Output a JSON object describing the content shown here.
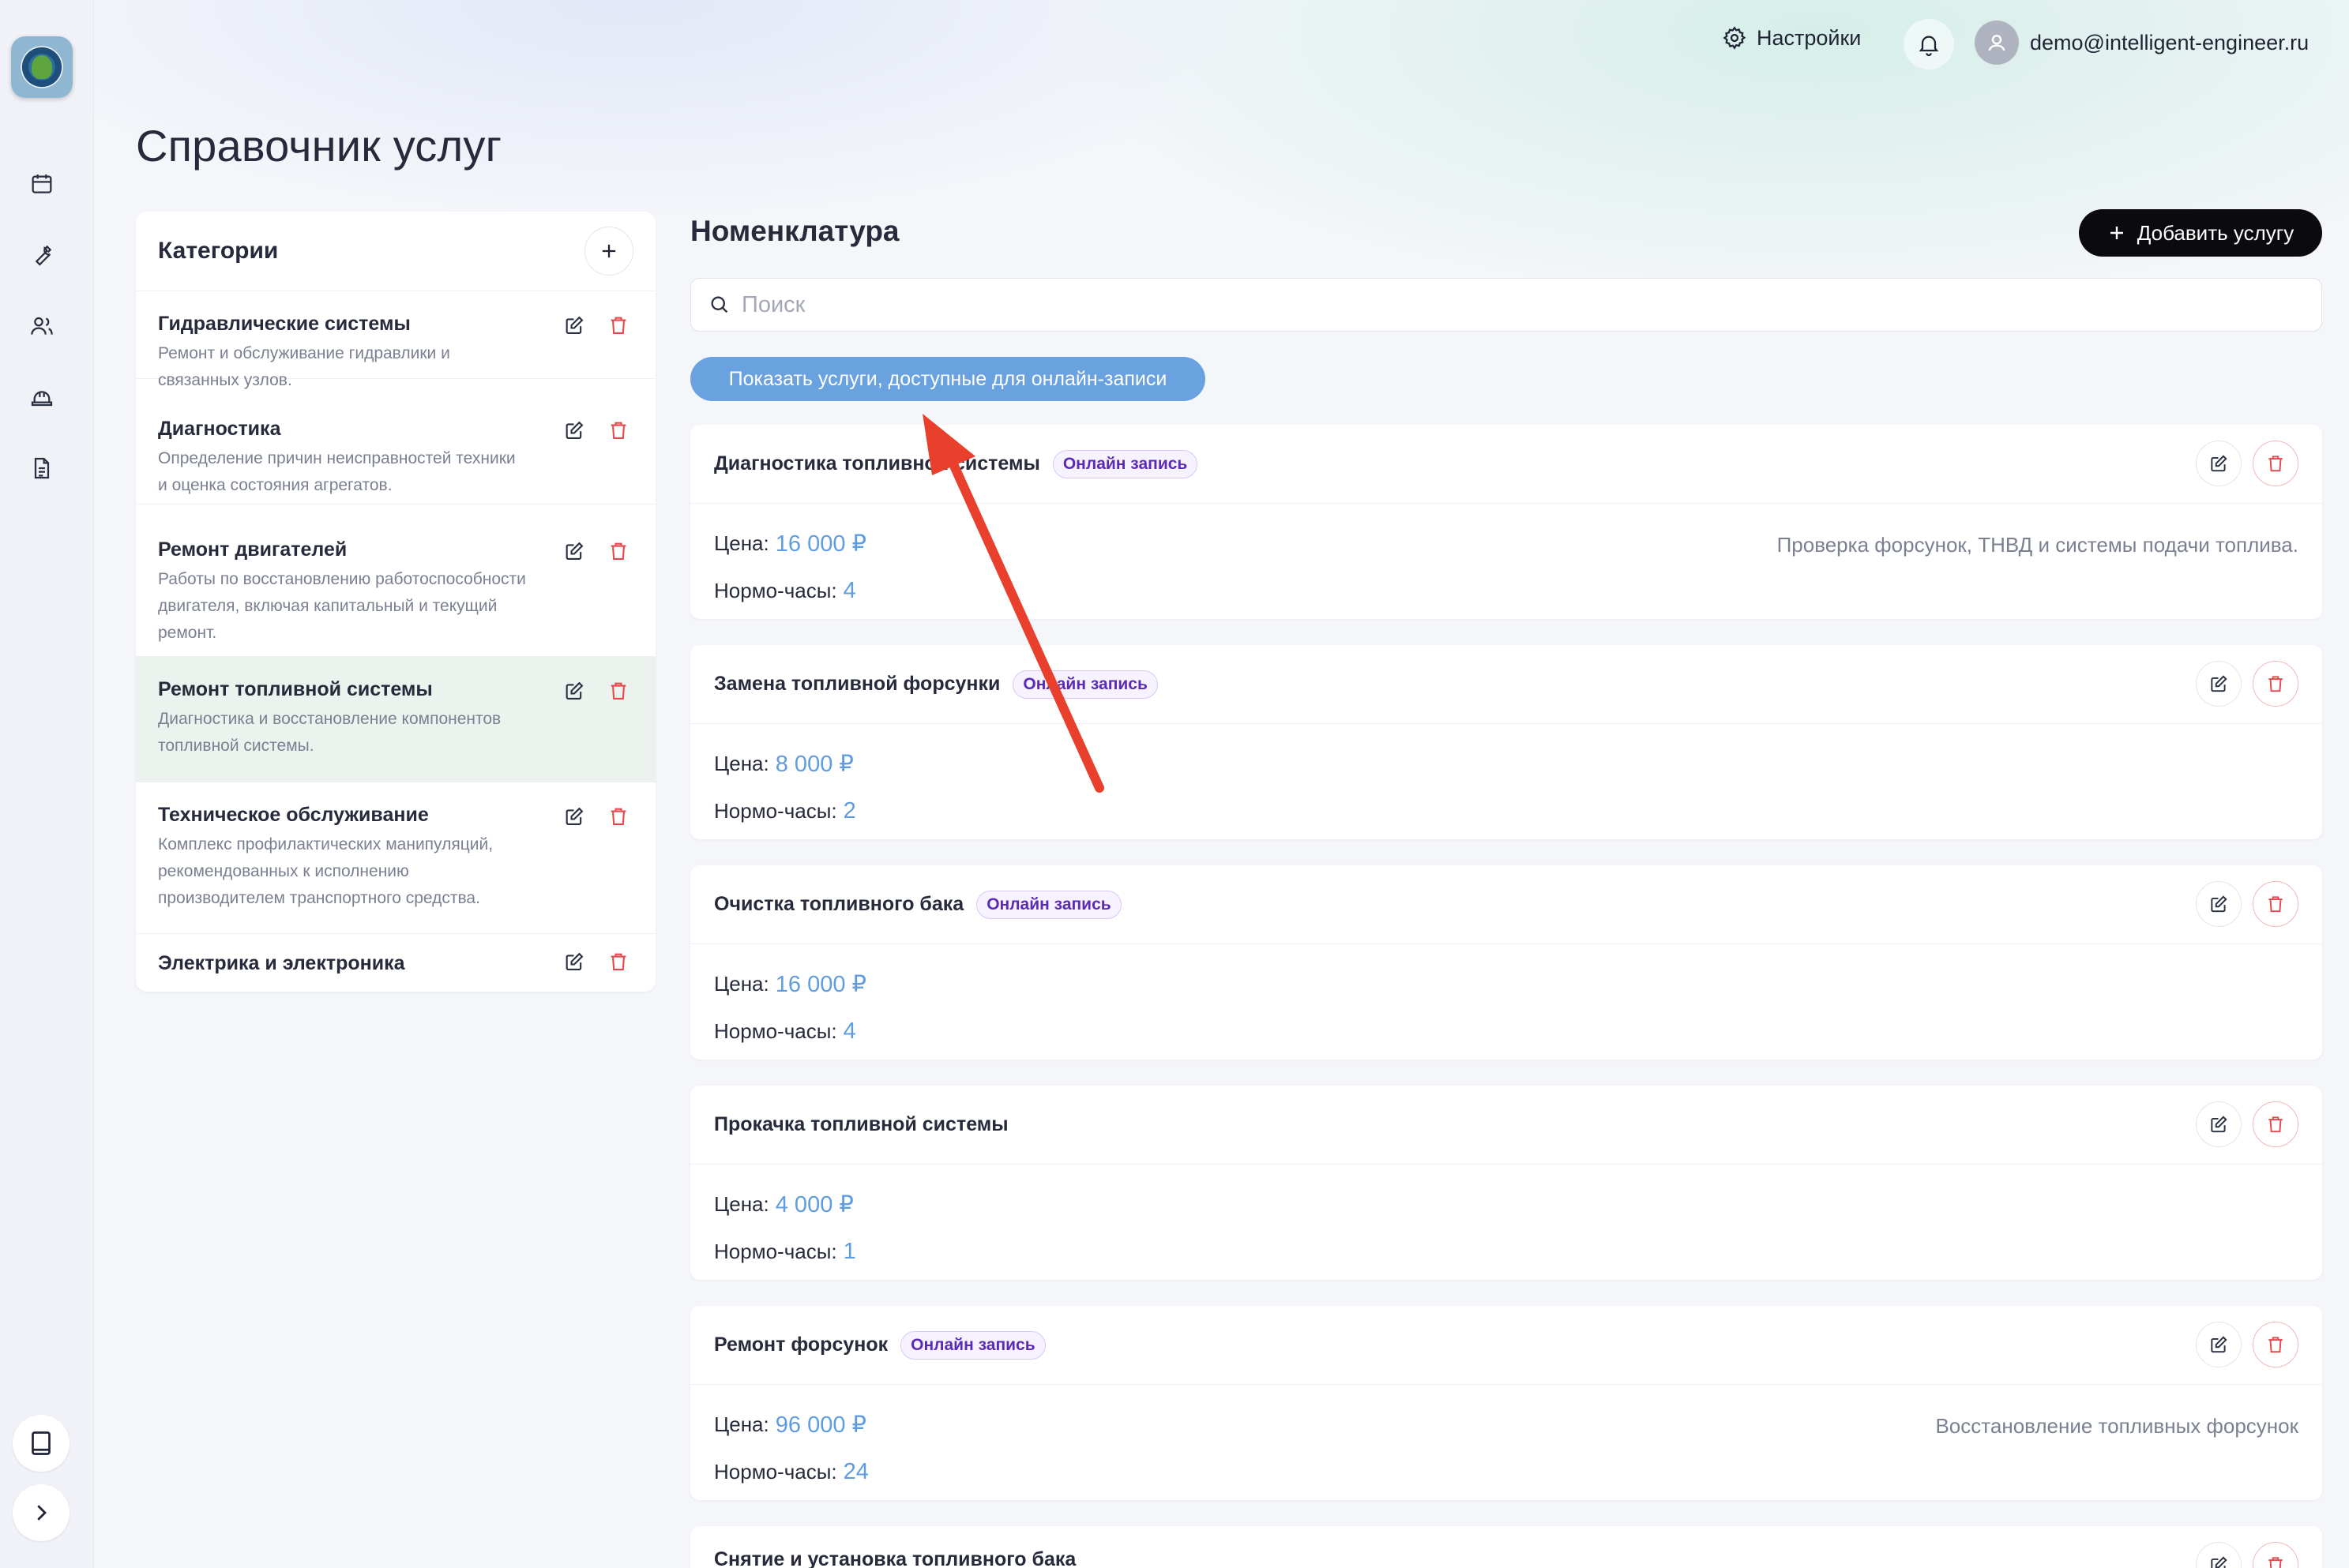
{
  "header": {
    "settings_label": "Настройки",
    "user_email": "demo@intelligent-engineer.ru"
  },
  "page": {
    "title": "Справочник услуг"
  },
  "categories": {
    "title": "Категории",
    "items": [
      {
        "name": "Гидравлические системы",
        "desc": "Ремонт и обслуживание гидравлики и связанных узлов."
      },
      {
        "name": "Диагностика",
        "desc": "Определение причин неисправностей техники и оценка состояния агрегатов."
      },
      {
        "name": "Ремонт двигателей",
        "desc": "Работы по восстановлению работоспособности двигателя, включая капитальный и текущий ремонт."
      },
      {
        "name": "Ремонт топливной системы",
        "desc": "Диагностика и восстановление компонентов топливной системы."
      },
      {
        "name": "Техническое обслуживание",
        "desc": "Комплекс профилактических манипуляций, рекомендованных к исполнению производителем транспортного средства."
      },
      {
        "name": "Электрика и электроника",
        "desc": ""
      }
    ]
  },
  "nomenclature": {
    "title": "Номенклатура",
    "add_label": "Добавить услугу",
    "search_placeholder": "Поиск",
    "filter_label": "Показать услуги, доступные для онлайн-записи",
    "price_label": "Цена:",
    "hours_label": "Нормо-часы:",
    "badge_label": "Онлайн запись",
    "services": [
      {
        "name": "Диагностика топливной системы",
        "badge": "Онлайн запись",
        "price": "16 000 ₽",
        "hours": "4",
        "desc": "Проверка форсунок, ТНВД и системы подачи топлива."
      },
      {
        "name": "Замена топливной форсунки",
        "badge": "Онлайн запись",
        "price": "8 000 ₽",
        "hours": "2",
        "desc": ""
      },
      {
        "name": "Очистка топливного бака",
        "badge": "Онлайн запись",
        "price": "16 000 ₽",
        "hours": "4",
        "desc": ""
      },
      {
        "name": "Прокачка топливной системы",
        "badge": "",
        "price": "4 000 ₽",
        "hours": "1",
        "desc": ""
      },
      {
        "name": "Ремонт форсунок",
        "badge": "Онлайн запись",
        "price": "96 000 ₽",
        "hours": "24",
        "desc": "Восстановление топливных форсунок"
      },
      {
        "name": "Снятие и установка топливного бака",
        "badge": "",
        "price": "",
        "hours": "",
        "desc": ""
      }
    ]
  },
  "icons": {
    "rail": [
      "calendar-icon",
      "wrench-icon",
      "users-icon",
      "hard-hat-icon",
      "document-icon"
    ],
    "rail_bottom": [
      "book-icon",
      "chevron-right-icon"
    ]
  },
  "colors": {
    "accent": "#5f9de0",
    "filter": "#6aa2e0",
    "danger": "#e5484d",
    "badge": "#5b2bb5",
    "arrow": "#e8402c"
  }
}
